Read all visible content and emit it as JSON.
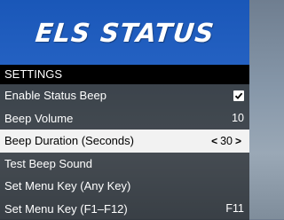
{
  "banner": {
    "title": "ELS STATUS"
  },
  "subtitle": "SETTINGS",
  "items": [
    {
      "label": "Enable Status Beep",
      "checked": true
    },
    {
      "label": "Beep Volume",
      "value": "10"
    },
    {
      "label": "Beep Duration (Seconds)",
      "value": "30",
      "left_arrow": "<",
      "right_arrow": ">",
      "selected": true
    },
    {
      "label": "Test Beep Sound"
    },
    {
      "label": "Set Menu Key (Any Key)"
    },
    {
      "label": "Set Menu Key (F1–F12)",
      "value": "F11"
    }
  ],
  "colors": {
    "banner": "#1a57b8",
    "subtitle_bg": "#000000",
    "selected_bg": "#f2f2f2"
  }
}
